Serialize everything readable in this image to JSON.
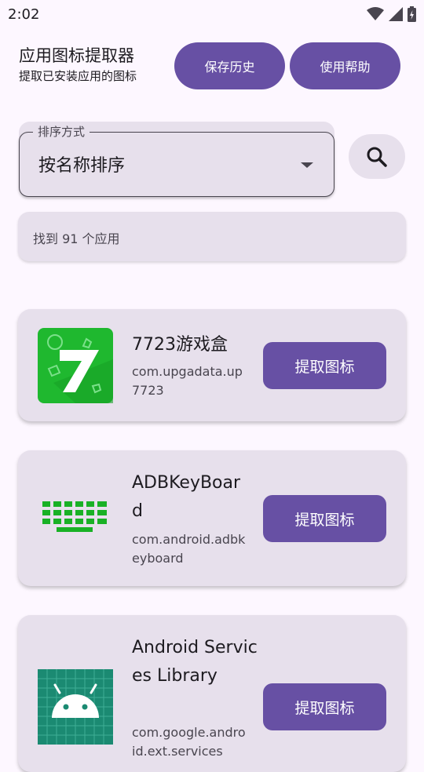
{
  "status_bar": {
    "time": "2:02"
  },
  "header": {
    "title": "应用图标提取器",
    "subtitle": "提取已安装应用的图标",
    "history_button": "保存历史",
    "help_button": "使用帮助"
  },
  "sort": {
    "label": "排序方式",
    "value": "按名称排序"
  },
  "summary": {
    "count_text": "找到 91 个应用"
  },
  "apps": [
    {
      "name": "7723游戏盒",
      "package": "com.upgadata.up7723",
      "action": "提取图标",
      "icon": "7723-app-icon"
    },
    {
      "name": "ADBKeyBoard",
      "package": "com.android.adbkeyboard",
      "action": "提取图标",
      "icon": "keyboard-app-icon"
    },
    {
      "name": "Android Services Library",
      "package": "com.google.android.ext.services",
      "action": "提取图标",
      "icon": "android-app-icon"
    }
  ],
  "colors": {
    "primary": "#6750a4",
    "surface": "#e7e0ec",
    "background": "#fdf7ff",
    "icon_7723_green": "#1fb82f",
    "keyboard_green": "#19b125",
    "android_teal": "#1b8a72"
  }
}
